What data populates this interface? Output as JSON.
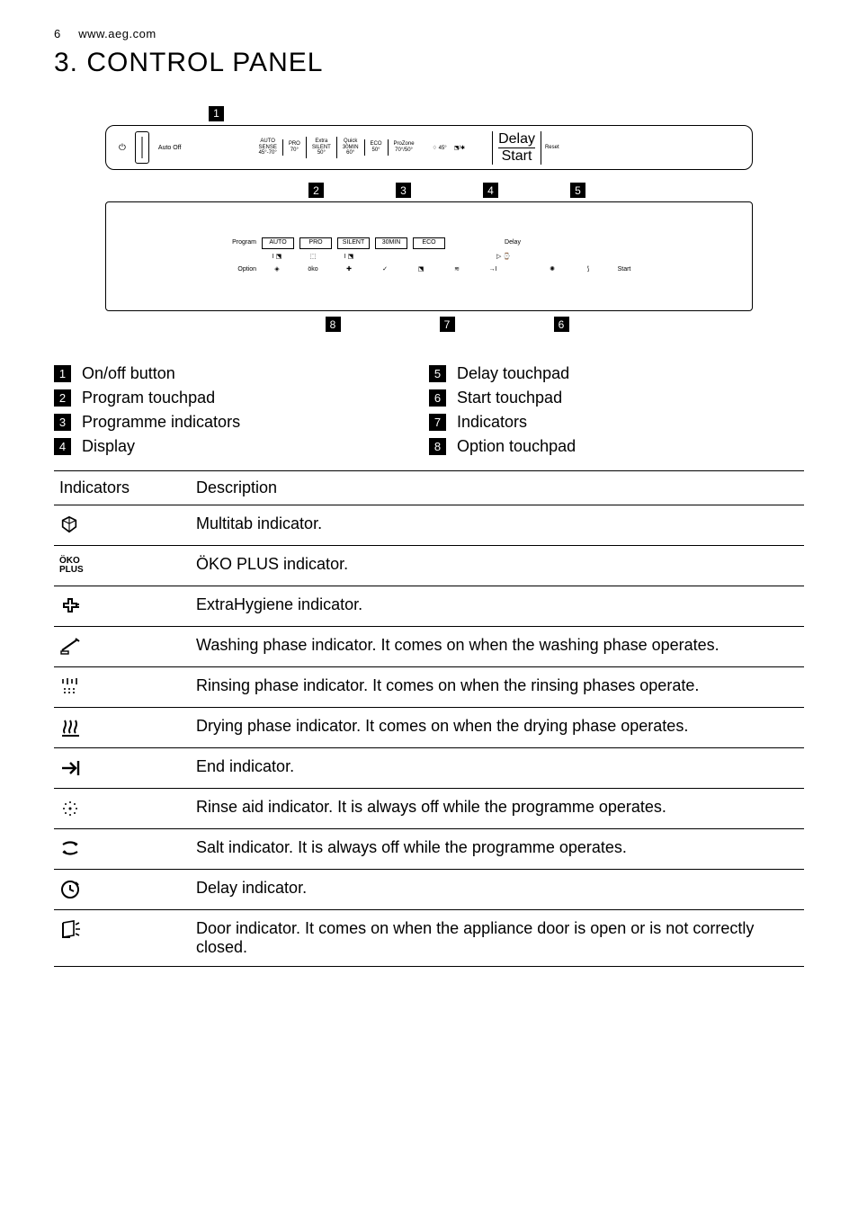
{
  "page_number": "6",
  "url": "www.aeg.com",
  "heading_number": "3.",
  "heading_text": "CONTROL PANEL",
  "top_panel": {
    "auto_off_label": "Auto Off",
    "programs": [
      {
        "line1": "AUTO",
        "line2": "SENSE",
        "line3": "45°-70°"
      },
      {
        "line1": "PRO",
        "line2": "70°",
        "line3": ""
      },
      {
        "line1": "Extra",
        "line2": "SILENT",
        "line3": "50°"
      },
      {
        "line1": "Quick",
        "line2": "30MIN",
        "line3": "60°"
      },
      {
        "line1": "ECO",
        "line2": "50°",
        "line3": ""
      },
      {
        "line1": "ProZone",
        "line2": "70°/50°",
        "line3": ""
      }
    ],
    "glass_label": "45°",
    "delay_label": "Delay",
    "start_label": "Start",
    "reset_label": "Reset"
  },
  "detail_panel": {
    "row_program_label": "Program",
    "row_program_items": [
      "AUTO",
      "PRO",
      "SILENT",
      "30MIN",
      "ECO"
    ],
    "row_option_label": "Option",
    "delay_label": "Delay",
    "start_label": "Start"
  },
  "callouts_top_upper": [
    "1"
  ],
  "callouts_detail_top": [
    "2",
    "3",
    "4",
    "5"
  ],
  "callouts_detail_bottom": [
    "8",
    "7",
    "6"
  ],
  "legend_left": [
    {
      "num": "1",
      "bold": "",
      "rest": "On/off button"
    },
    {
      "num": "2",
      "bold": "Program",
      "rest": " touchpad"
    },
    {
      "num": "3",
      "bold": "",
      "rest": "Programme indicators"
    },
    {
      "num": "4",
      "bold": "",
      "rest": "Display"
    }
  ],
  "legend_right": [
    {
      "num": "5",
      "bold": "Delay",
      "rest": " touchpad"
    },
    {
      "num": "6",
      "bold": "Start",
      "rest": " touchpad"
    },
    {
      "num": "7",
      "bold": "",
      "rest": "Indicators"
    },
    {
      "num": "8",
      "bold": "Option",
      "rest": " touchpad"
    }
  ],
  "table_headers": {
    "indicators": "Indicators",
    "description": "Description"
  },
  "indicators": [
    {
      "icon": "multitab",
      "desc": "Multitab indicator."
    },
    {
      "icon": "oko",
      "desc": "ÖKO PLUS indicator."
    },
    {
      "icon": "hygiene",
      "desc": "ExtraHygiene indicator."
    },
    {
      "icon": "wash",
      "desc": "Washing phase indicator. It comes on when the washing phase operates."
    },
    {
      "icon": "rinse",
      "desc": "Rinsing phase indicator. It comes on when the rinsing phases operate."
    },
    {
      "icon": "dry",
      "desc": "Drying phase indicator. It comes on when the drying phase operates."
    },
    {
      "icon": "end",
      "desc": "End indicator."
    },
    {
      "icon": "rinseaid",
      "desc": "Rinse aid indicator. It is always off while the programme operates."
    },
    {
      "icon": "salt",
      "desc": "Salt indicator. It is always off while the programme operates."
    },
    {
      "icon": "delay",
      "desc": "Delay indicator."
    },
    {
      "icon": "door",
      "desc": "Door indicator. It comes on when the appliance door is open or is not correctly closed."
    }
  ],
  "oko_text_line1": "ÖKO",
  "oko_text_line2": "PLUS"
}
